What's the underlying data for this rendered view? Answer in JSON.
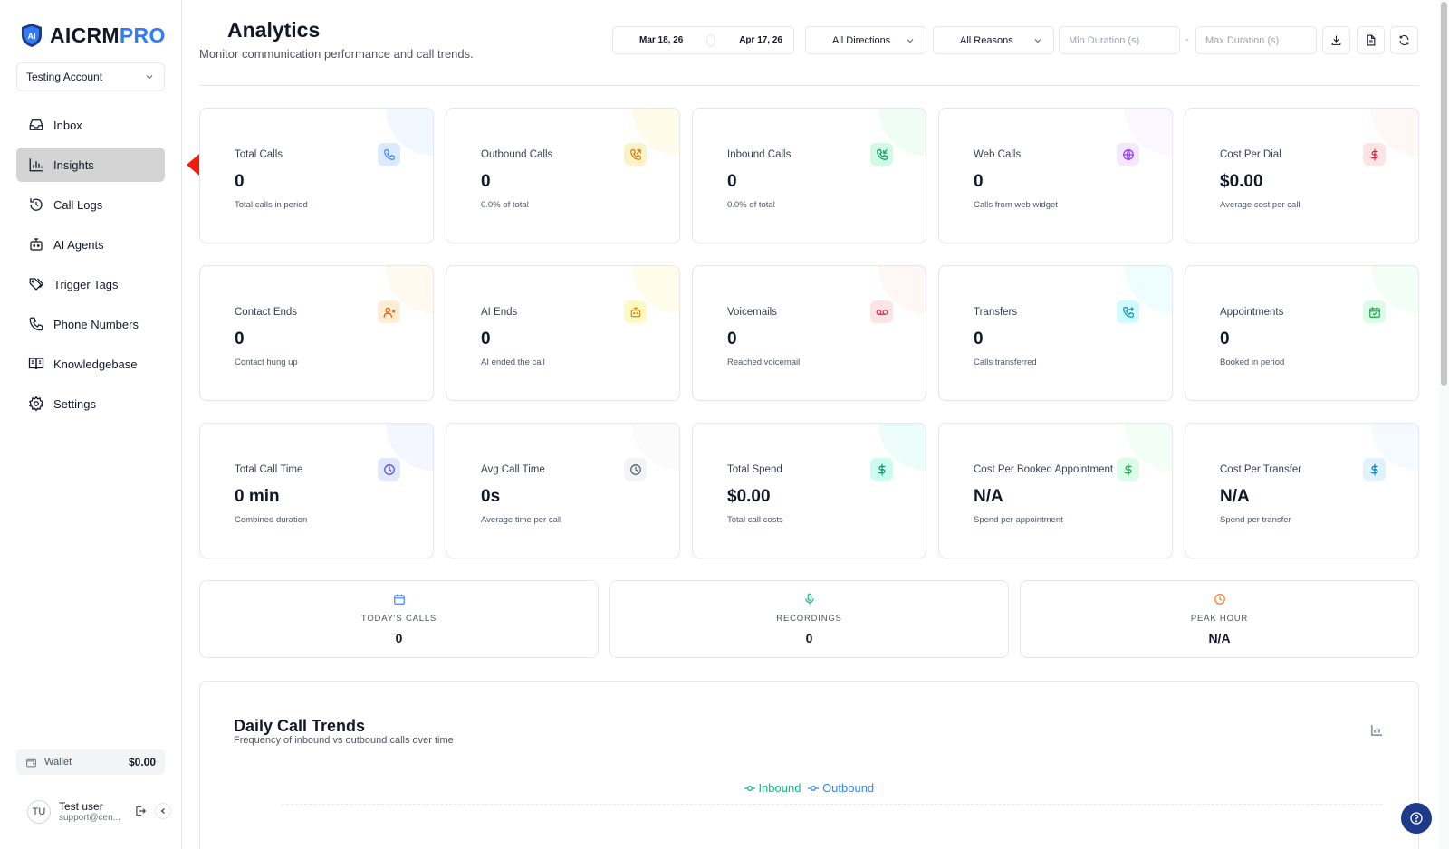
{
  "brand": {
    "part1": "AICRM",
    "part2": "PRO"
  },
  "account": {
    "name": "Testing Account"
  },
  "nav": [
    {
      "label": "Inbox",
      "icon": "inbox-icon"
    },
    {
      "label": "Insights",
      "icon": "bar-chart-icon",
      "active": true
    },
    {
      "label": "Call Logs",
      "icon": "history-icon"
    },
    {
      "label": "AI Agents",
      "icon": "bot-icon"
    },
    {
      "label": "Trigger Tags",
      "icon": "tags-icon"
    },
    {
      "label": "Phone Numbers",
      "icon": "phone-icon"
    },
    {
      "label": "Knowledgebase",
      "icon": "book-icon"
    },
    {
      "label": "Settings",
      "icon": "gear-icon"
    }
  ],
  "wallet": {
    "label": "Wallet",
    "amount": "$0.00"
  },
  "user": {
    "initials": "TU",
    "name": "Test user",
    "email": "support@cen..."
  },
  "header": {
    "title": "Analytics",
    "subtitle": "Monitor communication performance and call trends."
  },
  "filters": {
    "date_from": "Mar 18, 26",
    "date_to": "Apr 17, 26",
    "direction": "All Directions",
    "reason": "All Reasons",
    "min_placeholder": "Min Duration (s)",
    "max_placeholder": "Max Duration (s)",
    "range_sep": "-"
  },
  "stats": [
    {
      "label": "Total Calls",
      "value": "0",
      "sub": "Total calls in period",
      "icon": "phone-icon",
      "color": "#3b82f6",
      "bg": "#dbeafe"
    },
    {
      "label": "Outbound Calls",
      "value": "0",
      "sub": "0.0% of total",
      "icon": "phone-outgoing-icon",
      "color": "#d97706",
      "bg": "#fef3c7"
    },
    {
      "label": "Inbound Calls",
      "value": "0",
      "sub": "0.0% of total",
      "icon": "phone-incoming-icon",
      "color": "#059669",
      "bg": "#d1fae5"
    },
    {
      "label": "Web Calls",
      "value": "0",
      "sub": "Calls from web widget",
      "icon": "globe-icon",
      "color": "#9333ea",
      "bg": "#f3e8ff"
    },
    {
      "label": "Cost Per Dial",
      "value": "$0.00",
      "sub": "Average cost per call",
      "icon": "dollar-icon",
      "color": "#e11d48",
      "bg": "#ffe4e6"
    },
    {
      "label": "Contact Ends",
      "value": "0",
      "sub": "Contact hung up",
      "icon": "user-x-icon",
      "color": "#ea580c",
      "bg": "#ffedd5"
    },
    {
      "label": "AI Ends",
      "value": "0",
      "sub": "AI ended the call",
      "icon": "bot-icon",
      "color": "#ca8a04",
      "bg": "#fef9c3"
    },
    {
      "label": "Voicemails",
      "value": "0",
      "sub": "Reached voicemail",
      "icon": "voicemail-icon",
      "color": "#e11d48",
      "bg": "#ffe4e6"
    },
    {
      "label": "Transfers",
      "value": "0",
      "sub": "Calls transferred",
      "icon": "phone-forward-icon",
      "color": "#0891b2",
      "bg": "#cffafe"
    },
    {
      "label": "Appointments",
      "value": "0",
      "sub": "Booked in period",
      "icon": "calendar-check-icon",
      "color": "#16a34a",
      "bg": "#dcfce7"
    },
    {
      "label": "Total Call Time",
      "value": "0 min",
      "sub": "Combined duration",
      "icon": "clock-icon",
      "color": "#4f46e5",
      "bg": "#e0e7ff"
    },
    {
      "label": "Avg Call Time",
      "value": "0s",
      "sub": "Average time per call",
      "icon": "clock-icon",
      "color": "#4b5563",
      "bg": "#f3f4f6"
    },
    {
      "label": "Total Spend",
      "value": "$0.00",
      "sub": "Total call costs",
      "icon": "dollar-icon",
      "color": "#059669",
      "bg": "#ccfbf1"
    },
    {
      "label": "Cost Per Booked Appointment",
      "value": "N/A",
      "sub": "Spend per appointment",
      "icon": "dollar-icon",
      "color": "#16a34a",
      "bg": "#dcfce7"
    },
    {
      "label": "Cost Per Transfer",
      "value": "N/A",
      "sub": "Spend per transfer",
      "icon": "dollar-icon",
      "color": "#0284c7",
      "bg": "#e0f2fe"
    }
  ],
  "mini_stats": [
    {
      "label": "TODAY'S CALLS",
      "value": "0",
      "icon": "calendar-icon",
      "color": "#3b82f6"
    },
    {
      "label": "RECORDINGS",
      "value": "0",
      "icon": "mic-icon",
      "color": "#10b981"
    },
    {
      "label": "PEAK HOUR",
      "value": "N/A",
      "icon": "clock-icon",
      "color": "#f97316"
    }
  ],
  "trends": {
    "title": "Daily Call Trends",
    "subtitle": "Frequency of inbound vs outbound calls over time",
    "legend_inbound": "Inbound",
    "legend_outbound": "Outbound"
  }
}
